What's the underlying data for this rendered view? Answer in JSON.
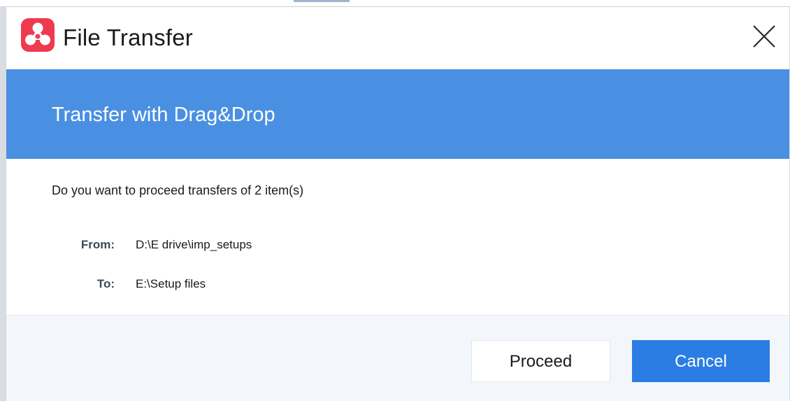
{
  "window": {
    "title": "File Transfer",
    "close_icon": "close-icon",
    "logo_icon": "app-logo-icon"
  },
  "banner": {
    "title": "Transfer with Drag&Drop"
  },
  "content": {
    "question": "Do you want to proceed transfers of 2 item(s)",
    "from_label": "From:",
    "from_value": "D:\\E drive\\imp_setups",
    "to_label": "To:",
    "to_value": "E:\\Setup files"
  },
  "buttons": {
    "proceed_label": "Proceed",
    "cancel_label": "Cancel"
  },
  "colors": {
    "banner": "#4a90e2",
    "primary_button": "#2b7de3",
    "logo": "#ee3a4f"
  }
}
